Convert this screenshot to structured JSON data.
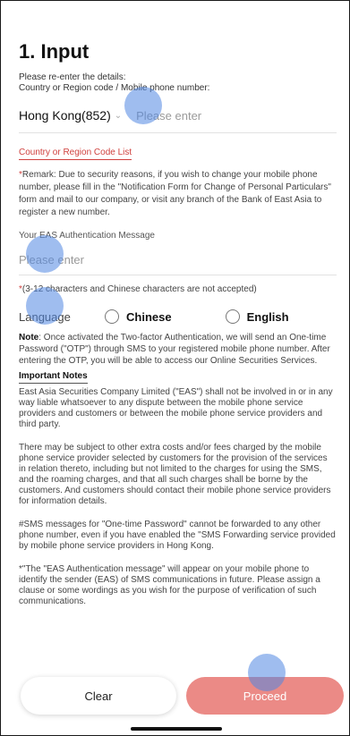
{
  "page": {
    "title": "1. Input"
  },
  "phone": {
    "instruction_line1": "Please re-enter the details:",
    "instruction_line2": "Country or Region code / Mobile phone number:",
    "country": "Hong Kong(852)",
    "chevron": "chevron-down-icon",
    "placeholder": "Please enter"
  },
  "country_link": "Country or Region Code List",
  "remark": {
    "star": "*",
    "text": "Remark: Due to security reasons, if you wish to change your mobile phone number, please fill in the \"Notification Form for Change of Personal Particulars\" form and mail to our company, or visit any branch of the Bank of East Asia to register a new number."
  },
  "eas_auth": {
    "label": "Your EAS Authentication Message",
    "placeholder": "Please enter",
    "hint_star": "*",
    "hint": "(3-12 characters and Chinese characters are not accepted)"
  },
  "language": {
    "label": "Language",
    "options": [
      "Chinese",
      "English"
    ]
  },
  "note": {
    "prefix": "Note",
    "text": ": Once activated the Two-factor Authentication, we will send an One-time Password (\"OTP\") through SMS to your registered mobile phone number. After entering the OTP, you will be able to access our Online Securities Services."
  },
  "important": {
    "title": "Important Notes",
    "paragraphs": [
      "East Asia Securities Company Limited (\"EAS\") shall not be involved in or in any way liable whatsoever to any dispute between the mobile phone service providers and customers or between the mobile phone service providers and third party.",
      "There may be subject to other extra costs and/or fees charged by the mobile phone service provider selected by customers for the provision of the services in relation thereto, including but not limited to the charges for using the SMS, and the roaming charges, and that all such charges shall be borne by the customers. And customers should contact their mobile phone service providers for information details.",
      "#SMS messages for \"One-time Password\" cannot be forwarded to any other phone number, even if you have enabled the \"SMS Forwarding service provided by mobile phone service providers in Hong Kong.",
      "*\"The \"EAS Authentication message\" will appear on your mobile phone to identify the sender (EAS) of SMS communications in future. Please assign a clause or some wordings as you wish for the purpose of verification of such communications."
    ]
  },
  "buttons": {
    "clear": "Clear",
    "proceed": "Proceed"
  },
  "colors": {
    "accent": "#d0413e",
    "proceed_bg": "#eb8a86",
    "touch": "#5087e1"
  }
}
